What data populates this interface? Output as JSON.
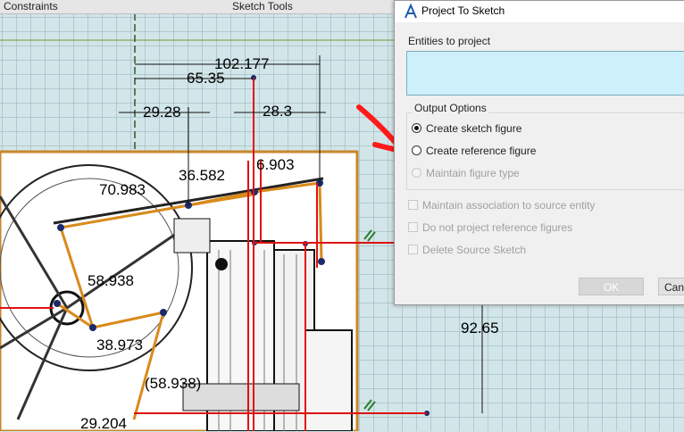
{
  "toolbar": {
    "constraints_label": "Constraints",
    "sketch_tools_label": "Sketch Tools"
  },
  "dimensions": {
    "d_overall": "102.177",
    "d_65": "65.35",
    "d_29": "29.28",
    "d_28": "28.3",
    "d_36": "36.582",
    "d_70": "70.983",
    "d_6903": "6.903",
    "d_58a": "58.938",
    "d_38": "38.973",
    "d_58b": "(58.938)",
    "d_29b": "29.204",
    "d_92": "92.65"
  },
  "dialog": {
    "title": "Project To Sketch",
    "entities_label": "Entities to project",
    "output_options_label": "Output Options",
    "radio_sketch_figure": "Create sketch figure",
    "radio_reference_figure": "Create reference figure",
    "radio_maintain_type": "Maintain figure type",
    "check_maintain_association": "Maintain association to source entity",
    "check_no_reference": "Do not project reference figures",
    "check_delete_source": "Delete Source Sketch",
    "ok_label": "OK",
    "cancel_label": "Can"
  },
  "colors": {
    "grid": "#8fb0b6",
    "accent_arrow": "#ff1a1a",
    "orange_frame": "#c8872a"
  }
}
